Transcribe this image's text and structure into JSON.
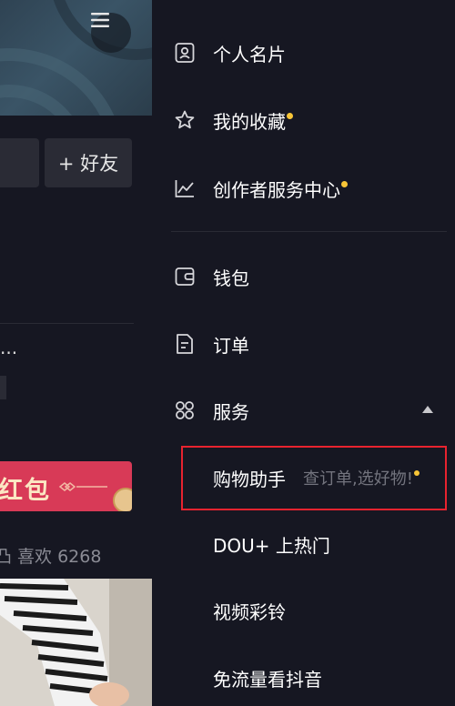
{
  "left": {
    "add_friend_label": "+ 好友",
    "truncated_text": "...",
    "red_banner_text": "红包",
    "likes_text": "凸 喜欢 6268"
  },
  "drawer": {
    "items": [
      {
        "label": "个人名片",
        "icon": "profile-card-icon",
        "dot": false
      },
      {
        "label": "我的收藏",
        "icon": "star-icon",
        "dot": true
      },
      {
        "label": "创作者服务中心",
        "icon": "chart-line-icon",
        "dot": true
      },
      {
        "label": "钱包",
        "icon": "wallet-icon",
        "dot": false
      },
      {
        "label": "订单",
        "icon": "document-icon",
        "dot": false
      },
      {
        "label": "服务",
        "icon": "apps-grid-icon",
        "dot": false,
        "expanded": true
      }
    ],
    "sub_items": [
      {
        "label": "购物助手",
        "hint": "查订单,选好物!",
        "dot": true,
        "highlighted": true
      },
      {
        "label": "DOU+ 上热门"
      },
      {
        "label": "视频彩铃"
      },
      {
        "label": "免流量看抖音"
      }
    ]
  },
  "colors": {
    "background": "#161722",
    "badge_dot": "#f8c537",
    "highlight_border": "#e8232f",
    "red_banner": "#d83a57"
  }
}
